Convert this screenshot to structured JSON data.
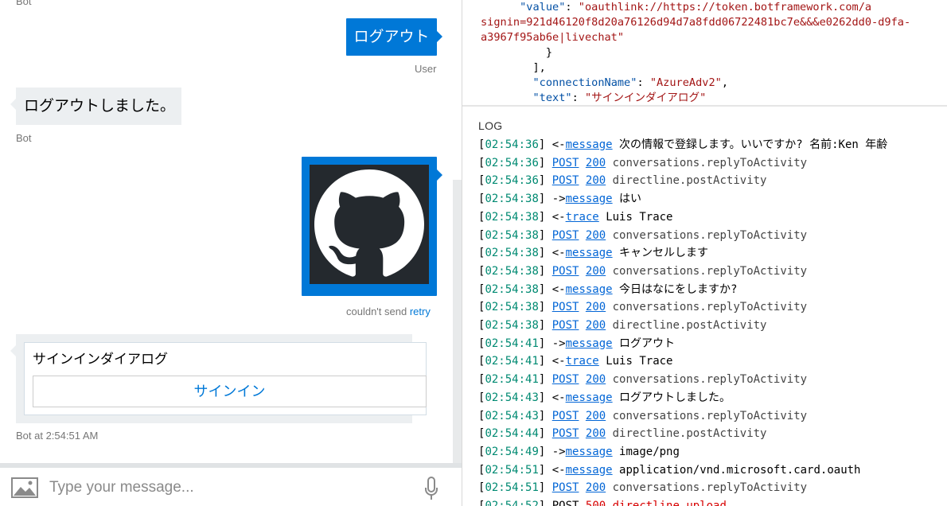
{
  "chat": {
    "top_label": "Bot",
    "messages": [
      {
        "from": "user",
        "text": "ログアウト",
        "meta": "User"
      },
      {
        "from": "bot",
        "text": "ログアウトしました。",
        "meta": "Bot"
      },
      {
        "from": "user",
        "type": "image",
        "image_name": "github-octocat-logo",
        "status": "couldn't send",
        "retry": "retry"
      },
      {
        "from": "bot",
        "type": "card",
        "card_title": "サインインダイアログ",
        "button": "サインイン",
        "meta": "Bot at 2:54:51 AM"
      }
    ],
    "input": {
      "placeholder": "Type your message..."
    }
  },
  "inspector": {
    "lines": [
      {
        "indent": "      ",
        "key": "\"value\"",
        "sep": ": ",
        "str": "\"oauthlink://https://token.botframework.com/a"
      },
      {
        "indent": "",
        "key": "",
        "sep": "",
        "str": "signin=921d46120f8d20a76126d94d7a8fdd06722481bc7e&&&e0262dd0-d9fa-"
      },
      {
        "indent": "",
        "key": "",
        "sep": "",
        "str": "a3967f95ab6e|livechat\""
      },
      {
        "indent": "          ",
        "key": "",
        "sep": "}",
        "str": ""
      },
      {
        "indent": "        ",
        "key": "",
        "sep": "],",
        "str": ""
      },
      {
        "indent": "        ",
        "key": "\"connectionName\"",
        "sep": ": ",
        "str": "\"AzureAdv2\"",
        "tail": ","
      },
      {
        "indent": "        ",
        "key": "\"text\"",
        "sep": ": ",
        "str": "\"サインインダイアログ\""
      }
    ]
  },
  "log": {
    "title": "LOG",
    "rows": [
      {
        "ts": "02:54:36",
        "dir": "<-",
        "link": "message",
        "text": "次の情報で登録します。いいですか? 名前:Ken 年齢"
      },
      {
        "ts": "02:54:36",
        "method": "POST",
        "code": "200",
        "text": "conversations.replyToActivity"
      },
      {
        "ts": "02:54:36",
        "method": "POST",
        "code": "200",
        "text": "directline.postActivity"
      },
      {
        "ts": "02:54:38",
        "dir": "->",
        "link": "message",
        "text": "はい"
      },
      {
        "ts": "02:54:38",
        "dir": "<-",
        "link": "trace",
        "text": "Luis Trace"
      },
      {
        "ts": "02:54:38",
        "method": "POST",
        "code": "200",
        "text": "conversations.replyToActivity"
      },
      {
        "ts": "02:54:38",
        "dir": "<-",
        "link": "message",
        "text": "キャンセルします"
      },
      {
        "ts": "02:54:38",
        "method": "POST",
        "code": "200",
        "text": "conversations.replyToActivity"
      },
      {
        "ts": "02:54:38",
        "dir": "<-",
        "link": "message",
        "text": "今日はなにをしますか?"
      },
      {
        "ts": "02:54:38",
        "method": "POST",
        "code": "200",
        "text": "conversations.replyToActivity"
      },
      {
        "ts": "02:54:38",
        "method": "POST",
        "code": "200",
        "text": "directline.postActivity"
      },
      {
        "ts": "02:54:41",
        "dir": "->",
        "link": "message",
        "text": "ログアウト"
      },
      {
        "ts": "02:54:41",
        "dir": "<-",
        "link": "trace",
        "text": "Luis Trace"
      },
      {
        "ts": "02:54:41",
        "method": "POST",
        "code": "200",
        "text": "conversations.replyToActivity"
      },
      {
        "ts": "02:54:43",
        "dir": "<-",
        "link": "message",
        "text": "ログアウトしました。"
      },
      {
        "ts": "02:54:43",
        "method": "POST",
        "code": "200",
        "text": "conversations.replyToActivity"
      },
      {
        "ts": "02:54:44",
        "method": "POST",
        "code": "200",
        "text": "directline.postActivity"
      },
      {
        "ts": "02:54:49",
        "dir": "->",
        "link": "message",
        "text": "image/png"
      },
      {
        "ts": "02:54:51",
        "dir": "<-",
        "link": "message",
        "text": "application/vnd.microsoft.card.oauth"
      },
      {
        "ts": "02:54:51",
        "method": "POST",
        "code": "200",
        "text": "conversations.replyToActivity"
      },
      {
        "ts": "02:54:52",
        "method": "POST",
        "code": "500",
        "text": "directline.upload",
        "error": true
      }
    ]
  },
  "colors": {
    "accent": "#0078d7",
    "timestamp": "#008a72",
    "link": "#0366d6",
    "error": "#d70000"
  }
}
